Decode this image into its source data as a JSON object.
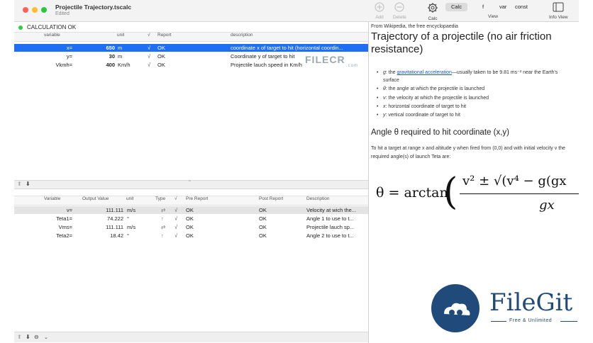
{
  "window": {
    "title": "Projectile Trajectory.tscalc",
    "subtitle": "Edited"
  },
  "toolbar": {
    "add_label": "Add",
    "delete_label": "Delete",
    "calc_label": "Calc",
    "seg_calc": "Calc",
    "seg_f": "f",
    "seg_var": "var",
    "seg_const": "const",
    "view_label": "View",
    "info_view_label": "Info View"
  },
  "status": {
    "text": "CALCULATION OK"
  },
  "input_table": {
    "headers": [
      "variable",
      "",
      "unit",
      "√",
      "Report",
      "description"
    ],
    "rows": [
      {
        "variable": "x=",
        "value": "650",
        "unit": "m",
        "check": "√",
        "report": "OK",
        "description": "coordinate x of target to hit (horizontal coordin..."
      },
      {
        "variable": "y=",
        "value": "30",
        "unit": "m",
        "check": "√",
        "report": "OK",
        "description": "Coordinate y of target to hit"
      },
      {
        "variable": "Vkmh=",
        "value": "400",
        "unit": "Km/h",
        "check": "√",
        "report": "OK",
        "description": "Projectile lauch speed in Km/h"
      }
    ]
  },
  "output_table": {
    "headers": [
      "Variable",
      "Output Value",
      "unit",
      "Type",
      "√",
      "Pre Report",
      "Post Report",
      "Description"
    ],
    "rows": [
      {
        "variable": "v=",
        "value": "111.111",
        "unit": "m/s",
        "type": "⇄",
        "check": "√",
        "pre": "OK",
        "post": "OK",
        "description": "Velocity at wich the..."
      },
      {
        "variable": "Teta1=",
        "value": "74.222",
        "unit": "°",
        "type": "↑",
        "check": "√",
        "pre": "OK",
        "post": "OK",
        "description": "Angle 1 to use to t..."
      },
      {
        "variable": "Vms=",
        "value": "111.111",
        "unit": "m/s",
        "type": "⇄",
        "check": "√",
        "pre": "OK",
        "post": "OK",
        "description": "Projectile lauch sp..."
      },
      {
        "variable": "Teta2=",
        "value": "18.42",
        "unit": "°",
        "type": "↑",
        "check": "√",
        "pre": "OK",
        "post": "OK",
        "description": "Angle 2 to use to t..."
      }
    ]
  },
  "info": {
    "source": "From Wikipedia, the free encyclopaedia",
    "title": "Trajectory of a projectile (no air friction resistance)",
    "bullets": [
      {
        "key": "g",
        "pre": ": the ",
        "link": "gravitational acceleration",
        "post": "—usually taken to be 9.81 ms⁻² near the Earth's surface"
      },
      {
        "key": "θ",
        "pre": ": the angle at which the projectile is launched",
        "link": "",
        "post": ""
      },
      {
        "key": "v",
        "pre": ": the velocity at which the projectile is launched",
        "link": "",
        "post": ""
      },
      {
        "key": "x",
        "pre": ": horizontal coordinate of target to hit",
        "link": "",
        "post": ""
      },
      {
        "key": "y",
        "pre": ": vertical coordinate of target to hit",
        "link": "",
        "post": ""
      }
    ],
    "h2": "Angle θ required to hit coordinate (x,y)",
    "paragraph": "To hit a target at range x and altitude y when fired from (0,0) and with initial velocity v the required angle(s) of launch Teta are:",
    "formula_lhs": "θ = arctan",
    "formula_num": "v² ± √(v⁴ − g(gx",
    "formula_den": "gx"
  },
  "watermarks": {
    "filegit": "FileGit",
    "filegit_sub": "Free & Unlimited",
    "filecr": "FILECR",
    "filecr_sub": ".com"
  },
  "colors": {
    "selection": "#1e6ff1",
    "status_ok": "#2ecc40",
    "link": "#1a56c4",
    "brand": "#1f4a7a"
  }
}
